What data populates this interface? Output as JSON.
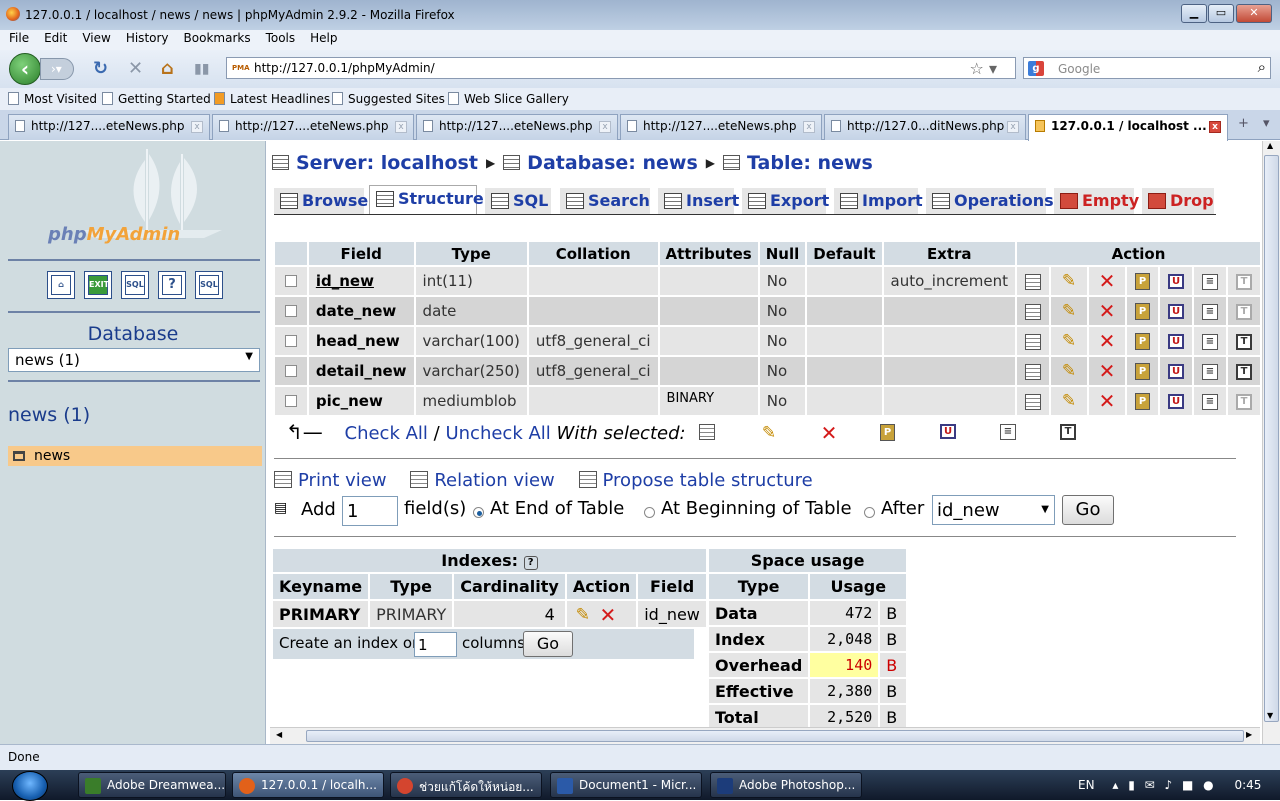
{
  "window": {
    "title": "127.0.0.1 / localhost / news / news | phpMyAdmin 2.9.2 - Mozilla Firefox"
  },
  "menu": [
    "File",
    "Edit",
    "View",
    "History",
    "Bookmarks",
    "Tools",
    "Help"
  ],
  "nav": {
    "url": "http://127.0.0.1/phpMyAdmin/",
    "search_placeholder": "Google"
  },
  "bookmarks": [
    "Most Visited",
    "Getting Started",
    "Latest Headlines",
    "Suggested Sites",
    "Web Slice Gallery"
  ],
  "tabs": [
    "http://127....eteNews.php",
    "http://127....eteNews.php",
    "http://127....eteNews.php",
    "http://127....eteNews.php",
    "http://127.0...ditNews.php",
    "127.0.0.1 / localhost ..."
  ],
  "sidebar": {
    "logo_pre": "php",
    "logo_post": "MyAdmin",
    "database_label": "Database",
    "db_select": "news (1)",
    "db_name": "news (1)",
    "table_item": "news",
    "icon_labels": [
      "EXIT",
      "SQL",
      "?",
      "SQL"
    ]
  },
  "breadcrumb": {
    "server": "Server: localhost",
    "database": "Database: news",
    "table": "Table: news"
  },
  "pma_tabs": [
    "Browse",
    "Structure",
    "SQL",
    "Search",
    "Insert",
    "Export",
    "Import",
    "Operations",
    "Empty",
    "Drop"
  ],
  "fields_table": {
    "headers": [
      "Field",
      "Type",
      "Collation",
      "Attributes",
      "Null",
      "Default",
      "Extra",
      "Action"
    ],
    "rows": [
      {
        "field": "id_new",
        "type": "int(11)",
        "collation": "",
        "attributes": "",
        "null": "No",
        "default": "",
        "extra": "auto_increment"
      },
      {
        "field": "date_new",
        "type": "date",
        "collation": "",
        "attributes": "",
        "null": "No",
        "default": "",
        "extra": ""
      },
      {
        "field": "head_new",
        "type": "varchar(100)",
        "collation": "utf8_general_ci",
        "attributes": "",
        "null": "No",
        "default": "",
        "extra": ""
      },
      {
        "field": "detail_new",
        "type": "varchar(250)",
        "collation": "utf8_general_ci",
        "attributes": "",
        "null": "No",
        "default": "",
        "extra": ""
      },
      {
        "field": "pic_new",
        "type": "mediumblob",
        "collation": "",
        "attributes": "BINARY",
        "null": "No",
        "default": "",
        "extra": ""
      }
    ]
  },
  "selection": {
    "check_all": "Check All",
    "separator": "/",
    "uncheck_all": "Uncheck All",
    "with_selected": "With selected:"
  },
  "links": {
    "print_view": "Print view",
    "relation_view": "Relation view",
    "propose": "Propose table structure"
  },
  "add_field": {
    "add": "Add",
    "count": "1",
    "fields_label": "field(s)",
    "at_end": "At End of Table",
    "at_begin": "At Beginning of Table",
    "after": "After",
    "after_value": "id_new",
    "go": "Go"
  },
  "indexes": {
    "title": "Indexes:",
    "headers": [
      "Keyname",
      "Type",
      "Cardinality",
      "Action",
      "Field"
    ],
    "row": {
      "keyname": "PRIMARY",
      "type": "PRIMARY",
      "cardinality": "4",
      "field": "id_new"
    },
    "create_label": "Create an index on",
    "create_count": "1",
    "columns_label": "columns",
    "go": "Go"
  },
  "space_usage": {
    "title": "Space usage",
    "headers": [
      "Type",
      "Usage"
    ],
    "rows": [
      {
        "type": "Data",
        "value": "472",
        "unit": "B"
      },
      {
        "type": "Index",
        "value": "2,048",
        "unit": "B"
      },
      {
        "type": "Overhead",
        "value": "140",
        "unit": "B"
      },
      {
        "type": "Effective",
        "value": "2,380",
        "unit": "B"
      },
      {
        "type": "Total",
        "value": "2,520",
        "unit": "B"
      }
    ]
  },
  "status": "Done",
  "taskbar": {
    "items": [
      "Adobe Dreamwea...",
      "127.0.0.1 / localh...",
      "ช่วยแก้โค้ดให้หน่อย...",
      "Document1 - Micr...",
      "Adobe Photoshop..."
    ],
    "lang": "EN",
    "time": "0:45"
  }
}
